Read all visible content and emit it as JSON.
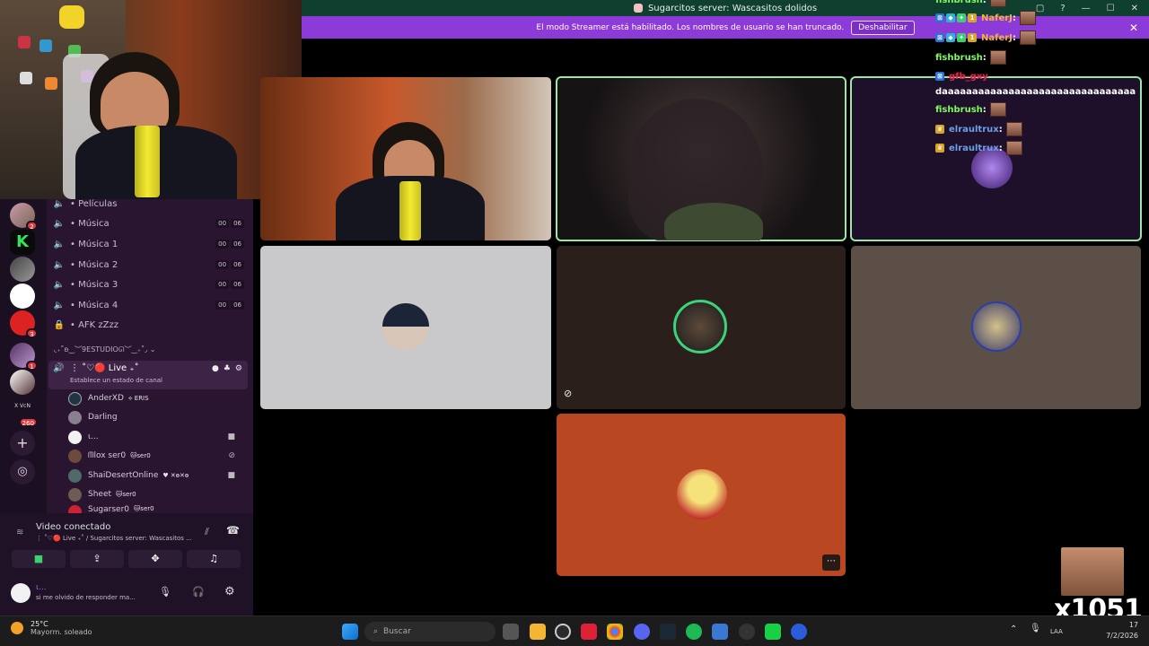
{
  "titlebar": {
    "title": "Sugarcitos server: Wascasitos dolidos"
  },
  "streamer_banner": {
    "text": "El modo Streamer está habilitado. Los nombres de usuario se han truncado.",
    "button": "Deshabilitar"
  },
  "rail": {
    "badges": [
      "2",
      "3",
      "1",
      "260"
    ],
    "vcn_label": "X VcN"
  },
  "channels": [
    {
      "icon": "video-icon",
      "name": "• Películas"
    },
    {
      "icon": "speaker-icon",
      "name": "• Música",
      "counts": [
        "00",
        "06"
      ]
    },
    {
      "icon": "speaker-icon",
      "name": "• Música 1",
      "counts": [
        "00",
        "06"
      ]
    },
    {
      "icon": "speaker-icon",
      "name": "• Música 2",
      "counts": [
        "00",
        "06"
      ]
    },
    {
      "icon": "speaker-icon",
      "name": "• Música 3",
      "counts": [
        "00",
        "06"
      ]
    },
    {
      "icon": "speaker-icon",
      "name": "• Música 4",
      "counts": [
        "00",
        "06"
      ]
    },
    {
      "icon": "lock-icon",
      "name": "• AFK zZzz"
    }
  ],
  "category": "◟₊˚ʚ‿︶9ESTUDIOᘏ︶‿₊˚◞ ⌄",
  "live_channel": {
    "name": "⋮ ˚♡🔴 Live ₊˚",
    "status": "Establece un estado de canal"
  },
  "users": [
    {
      "name": "AnderXD",
      "tag": "⟡ ERIS",
      "color": "#9bb4ae"
    },
    {
      "name": "Darling",
      "tag": "",
      "color": "#8a7f8e"
    },
    {
      "name": "ι...",
      "tag": "",
      "color": "#f2f2f2"
    },
    {
      "name": "ᗰlox ser0",
      "tag": "🐱ser0",
      "color": "#6b4b3b"
    },
    {
      "name": "ShaiDesertOnline",
      "tag": "♥ ✕ɵ✕ɵ",
      "color": "#4e6b6a"
    },
    {
      "name": "Sheet",
      "tag": "🐱ser0",
      "color": "#6e5b54"
    },
    {
      "name": "Sugarser0",
      "tag": "🐱ser0",
      "color": "#c23"
    }
  ],
  "voice": {
    "status": "Video conectado",
    "sub": "⋮ ˚♡🔴 Live ₊˚ / Sugarcitos server: Wascasitos ...",
    "me_name": "ι...",
    "me_status": "si me olvido de responder ma..."
  },
  "chat": [
    {
      "user": "fishbrush",
      "color": "#7dfc5a"
    },
    {
      "user": "NaferJ",
      "color": "#f3b23c"
    },
    {
      "user": "NaferJ",
      "color": "#f3b23c"
    },
    {
      "user": "fishbrush",
      "color": "#7dfc5a"
    },
    {
      "user": "gfb_gxy",
      "color": "#e02a4f"
    },
    {
      "message": "daaaaaaaaaaaaaaaaaaaaaaaaaaaaaaaa"
    },
    {
      "user": "fishbrush",
      "color": "#7dfc5a"
    },
    {
      "user": "elraultrux",
      "color": "#6aa0e8"
    },
    {
      "user": "elraultrux",
      "color": "#6aa0e8"
    }
  ],
  "taskbar": {
    "weather_temp": "25°C",
    "weather_desc": "Mayorm. soleado",
    "search": "Buscar",
    "time": "17",
    "date": "7/2/2026",
    "lang": "LAA"
  },
  "counter": {
    "value": "x1051"
  }
}
